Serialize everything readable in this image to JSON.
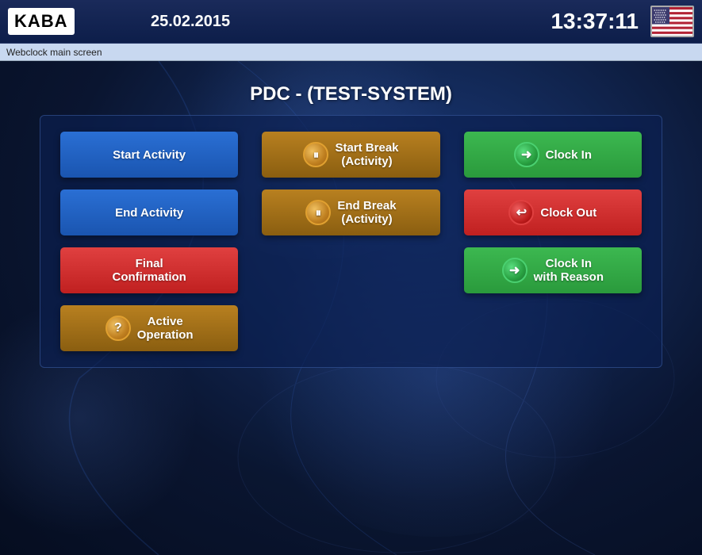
{
  "header": {
    "logo_text": "KABA",
    "date": "25.02.2015",
    "time": "13:37:11"
  },
  "navbar": {
    "label": "Webclock main screen"
  },
  "main": {
    "title": "PDC - (TEST-SYSTEM)",
    "buttons": [
      {
        "id": "start-activity",
        "label": "Start Activity",
        "style": "blue",
        "has_icon": false,
        "col": 1,
        "row": 1
      },
      {
        "id": "start-break-activity",
        "label": "Start Break\n(Activity)",
        "style": "gold",
        "has_icon": true,
        "icon_type": "coin-pause",
        "col": 2,
        "row": 1
      },
      {
        "id": "clock-in",
        "label": "Clock In",
        "style": "green",
        "has_icon": true,
        "icon_type": "arrow-in",
        "col": 3,
        "row": 1
      },
      {
        "id": "end-activity",
        "label": "End Activity",
        "style": "blue",
        "has_icon": false,
        "col": 1,
        "row": 2
      },
      {
        "id": "end-break-activity",
        "label": "End Break\n(Activity)",
        "style": "gold",
        "has_icon": true,
        "icon_type": "coin-pause2",
        "col": 2,
        "row": 2
      },
      {
        "id": "clock-out",
        "label": "Clock Out",
        "style": "red",
        "has_icon": true,
        "icon_type": "arrow-out",
        "col": 3,
        "row": 2
      },
      {
        "id": "final-confirmation",
        "label": "Final\nConfirmation",
        "style": "red",
        "has_icon": false,
        "col": 1,
        "row": 3
      },
      {
        "id": "clock-in-reason",
        "label": "Clock In\nwith Reason",
        "style": "green",
        "has_icon": true,
        "icon_type": "arrow-in",
        "col": 3,
        "row": 3
      },
      {
        "id": "active-operation",
        "label": "Active\nOperation",
        "style": "gold",
        "has_icon": true,
        "icon_type": "question",
        "col": 1,
        "row": 4
      }
    ]
  }
}
